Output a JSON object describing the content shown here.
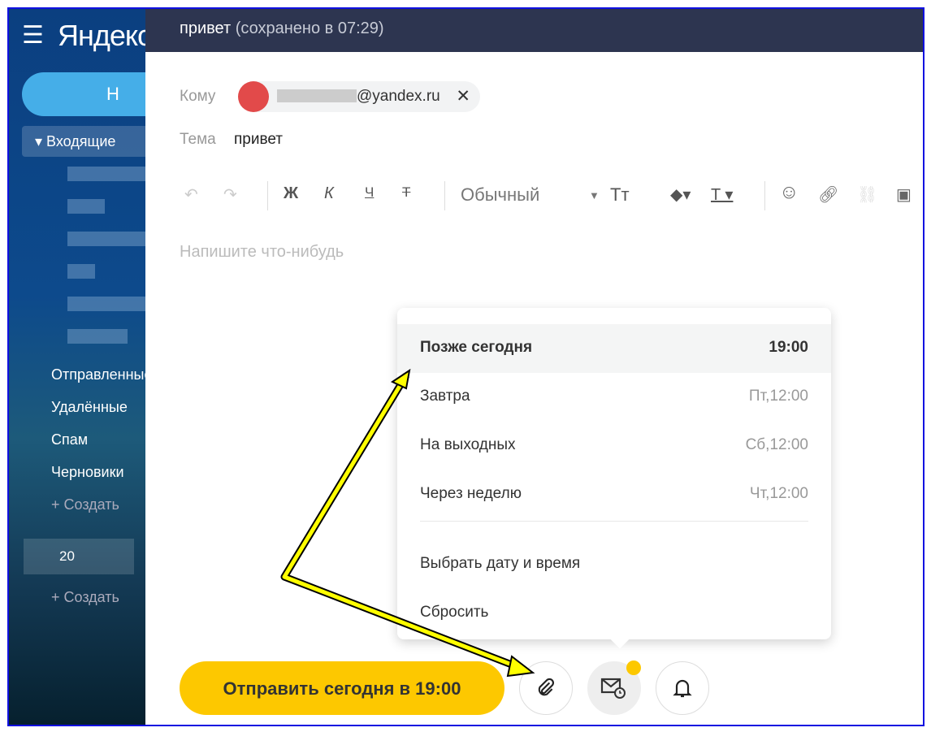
{
  "sidebar": {
    "logo": "Яндекс",
    "compose_label": "Н",
    "inbox": "▾ Входящие",
    "folders": [
      "Отправленные",
      "Удалённые",
      "Спам",
      "Черновики"
    ],
    "create_folder": "Создать",
    "flag_count": "20",
    "create_label": "Создать"
  },
  "header": {
    "subject": "привет",
    "saved": "(сохранено в 07:29)"
  },
  "fields": {
    "to_label": "Кому",
    "to_domain": "@yandex.ru",
    "subject_label": "Тема",
    "subject_value": "привет"
  },
  "toolbar": {
    "bold": "Ж",
    "italic": "К",
    "underline": "Ч",
    "strike": "Т",
    "style": "Обычный",
    "font_size": "Тт"
  },
  "body": {
    "placeholder": "Напишите что-нибудь"
  },
  "menu": {
    "items": [
      {
        "label": "Позже сегодня",
        "time": "19:00"
      },
      {
        "label": "Завтра",
        "time": "Пт,12:00"
      },
      {
        "label": "На выходных",
        "time": "Сб,12:00"
      },
      {
        "label": "Через неделю",
        "time": "Чт,12:00"
      }
    ],
    "pick": "Выбрать дату и время",
    "reset": "Сбросить"
  },
  "footer": {
    "send_label": "Отправить сегодня в 19:00"
  },
  "colors": {
    "send": "#fdc800",
    "header": "#2d3550",
    "arrow": "#ffff00"
  }
}
